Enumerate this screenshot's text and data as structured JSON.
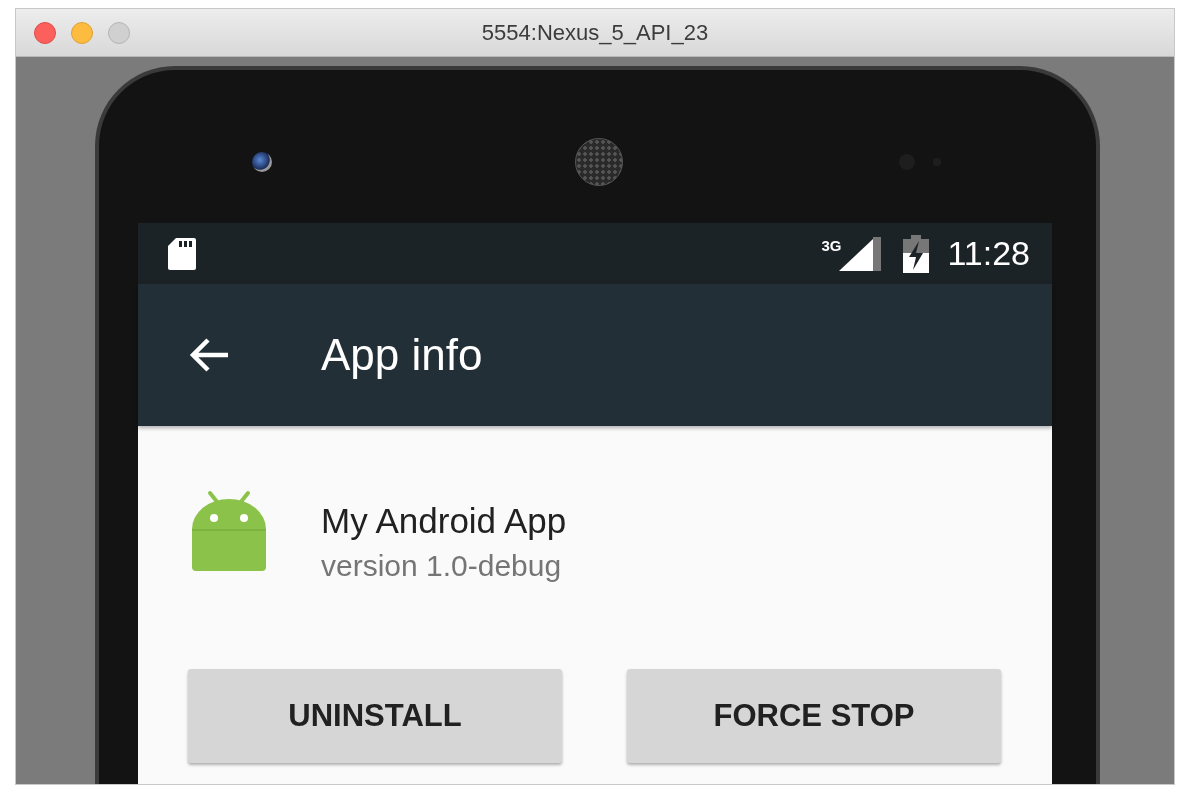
{
  "window": {
    "title": "5554:Nexus_5_API_23"
  },
  "status_bar": {
    "network": "3G",
    "time": "11:28"
  },
  "app_bar": {
    "title": "App info"
  },
  "app": {
    "name": "My Android App",
    "version": "version 1.0-debug"
  },
  "buttons": [
    "UNINSTALL",
    "FORCE STOP"
  ]
}
